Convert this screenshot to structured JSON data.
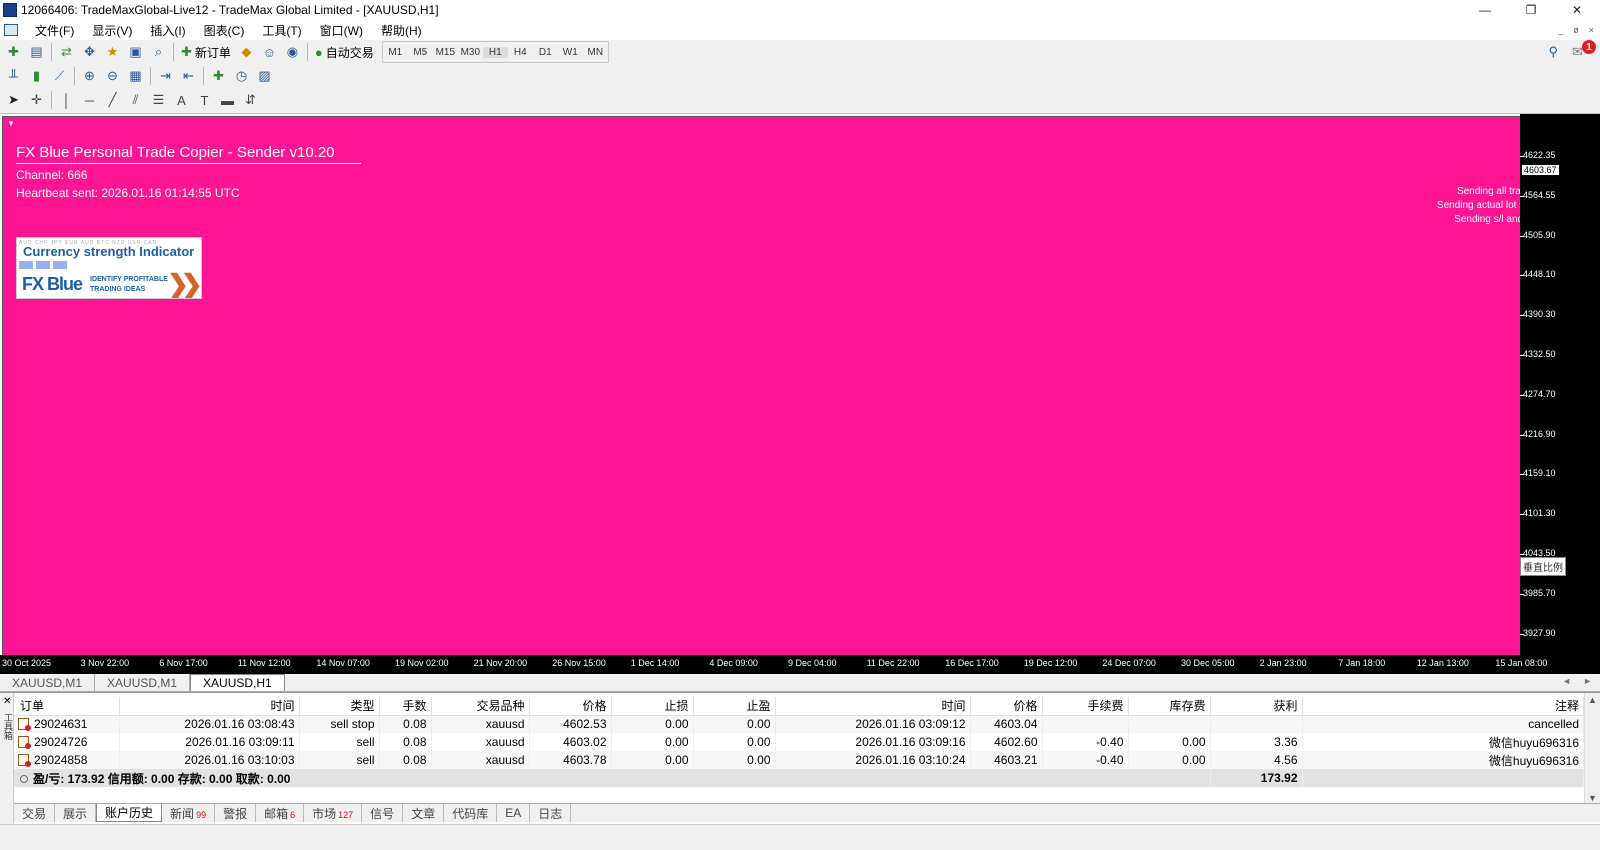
{
  "window": {
    "title": "12066406: TradeMaxGlobal-Live12 - TradeMax Global Limited - [XAUUSD,H1]",
    "min_glyph": "—",
    "restore_glyph": "❐",
    "close_glyph": "✕"
  },
  "menu": [
    "文件(F)",
    "显示(V)",
    "插入(I)",
    "图表(C)",
    "工具(T)",
    "窗口(W)",
    "帮助(H)"
  ],
  "mdi_controls": [
    "_",
    "ø",
    "×"
  ],
  "toolbar": {
    "new_order": "新订单",
    "auto_trading": "自动交易",
    "timeframes": [
      "M1",
      "M5",
      "M15",
      "M30",
      "H1",
      "H4",
      "D1",
      "W1",
      "MN"
    ],
    "active_timeframe": "H1",
    "notification_count": "1"
  },
  "chart": {
    "background": "#ff1493",
    "ea_title": "FX Blue Personal Trade Copier - Sender v10.20",
    "channel": "Channel: 666",
    "heartbeat": "Heartbeat sent: 2026.01.16 01:14:55 UTC",
    "dash": "--",
    "status_lines": [
      "Sending all trades",
      "Sending actual lot size",
      "Sending s/l and t/p"
    ],
    "banner": {
      "faint_row": "AUD CHF JPY EUR AUD BTC NZD USD CAD",
      "title": "Currency strength Indicator",
      "logo": "FX Blue",
      "tagline_1": "IDENTIFY PROFITABLE",
      "tagline_2": "TRADING IDEAS"
    },
    "price_labels": [
      "4622.35",
      "4564.55",
      "4505.90",
      "4448.10",
      "4390.30",
      "4332.50",
      "4274.70",
      "4216.90",
      "4159.10",
      "4101.30",
      "4043.50",
      "3985.70",
      "3927.90"
    ],
    "current_price": "4603.67",
    "vertical_scale_button": "垂直比例",
    "time_labels": [
      "30 Oct 2025",
      "3 Nov 22:00",
      "6 Nov 17:00",
      "11 Nov 12:00",
      "14 Nov 07:00",
      "19 Nov 02:00",
      "21 Nov 20:00",
      "26 Nov 15:00",
      "1 Dec 14:00",
      "4 Dec 09:00",
      "9 Dec 04:00",
      "11 Dec 22:00",
      "16 Dec 17:00",
      "19 Dec 12:00",
      "24 Dec 07:00",
      "30 Dec 05:00",
      "2 Jan 23:00",
      "7 Jan 18:00",
      "12 Jan 13:00",
      "15 Jan 08:00"
    ]
  },
  "chart_tabs": [
    "XAUUSD,M1",
    "XAUUSD,M1",
    "XAUUSD,H1"
  ],
  "tab_arrows": [
    "◄",
    "►"
  ],
  "terminal": {
    "side_label": "工具箱",
    "columns": [
      "订单",
      "时间",
      "类型",
      "手数",
      "交易品种",
      "价格",
      "止损",
      "止盈",
      "时间",
      "价格",
      "手续费",
      "库存费",
      "获利",
      "注释"
    ],
    "rows": [
      {
        "order": "29024631",
        "open_time": "2026.01.16 03:08:43",
        "type": "sell stop",
        "lots": "0.08",
        "symbol": "xauusd",
        "open_price": "4602.53",
        "sl": "0.00",
        "tp": "0.00",
        "close_time": "2026.01.16 03:09:12",
        "close_price": "4603.04",
        "commission": "",
        "swap": "",
        "profit": "",
        "comment": "cancelled"
      },
      {
        "order": "29024726",
        "open_time": "2026.01.16 03:09:11",
        "type": "sell",
        "lots": "0.08",
        "symbol": "xauusd",
        "open_price": "4603.02",
        "sl": "0.00",
        "tp": "0.00",
        "close_time": "2026.01.16 03:09:16",
        "close_price": "4602.60",
        "commission": "-0.40",
        "swap": "0.00",
        "profit": "3.36",
        "comment": "微信huyu696316"
      },
      {
        "order": "29024858",
        "open_time": "2026.01.16 03:10:03",
        "type": "sell",
        "lots": "0.08",
        "symbol": "xauusd",
        "open_price": "4603.78",
        "sl": "0.00",
        "tp": "0.00",
        "close_time": "2026.01.16 03:10:24",
        "close_price": "4603.21",
        "commission": "-0.40",
        "swap": "0.00",
        "profit": "4.56",
        "comment": "微信huyu696316"
      }
    ],
    "summary": {
      "text": "盈/亏: 173.92  信用额: 0.00  存款: 0.00  取款: 0.00",
      "profit": "173.92"
    }
  },
  "bottom_tabs": [
    {
      "label": "交易",
      "count": ""
    },
    {
      "label": "展示",
      "count": ""
    },
    {
      "label": "账户历史",
      "count": ""
    },
    {
      "label": "新闻",
      "count": "99"
    },
    {
      "label": "警报",
      "count": ""
    },
    {
      "label": "邮箱",
      "count": "6"
    },
    {
      "label": "市场",
      "count": "127"
    },
    {
      "label": "信号",
      "count": ""
    },
    {
      "label": "文章",
      "count": ""
    },
    {
      "label": "代码库",
      "count": ""
    },
    {
      "label": "EA",
      "count": ""
    },
    {
      "label": "日志",
      "count": ""
    }
  ],
  "active_bottom_tab": "账户历史",
  "statusbar": {
    "left": "",
    "mid": ""
  }
}
